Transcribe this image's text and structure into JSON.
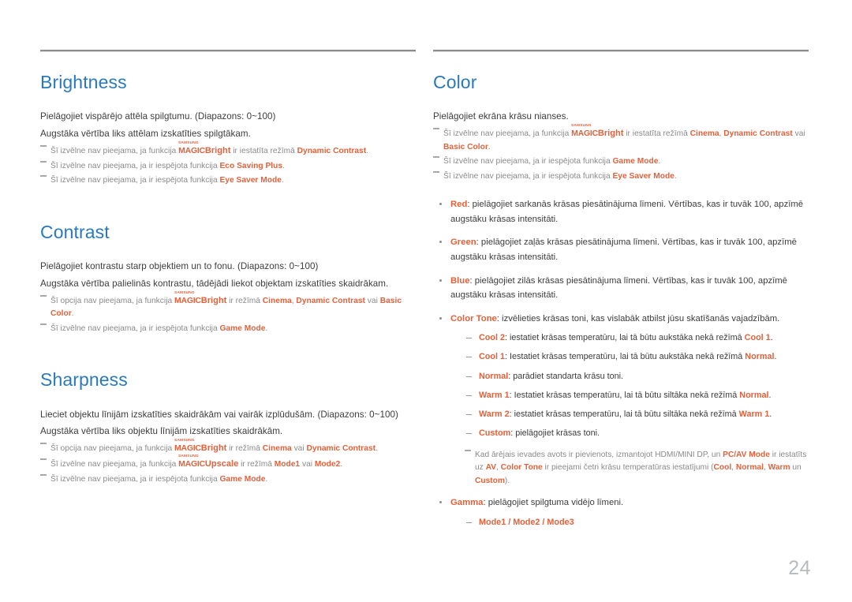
{
  "page": {
    "number": "24",
    "accent_color": "#e3613a",
    "heading_color": "#2b79bd",
    "body_color": "#3c3c3c",
    "note_color": "#8a8a8a"
  },
  "logo": {
    "samsung": "SAMSUNG",
    "magic": "MAGIC",
    "bright_suffix": "Bright",
    "upscale_suffix": "Upscale"
  },
  "left_column": {
    "sections": [
      {
        "title": "Brightness",
        "body": [
          "Pielāgojiet vispārējo attēla spilgtumu. (Diapazons: 0~100)",
          "Augstāka vērtība liks attēlam izskatīties spilgtākam."
        ],
        "notes": [
          {
            "pre": "Šī izvēlne nav pieejama, ja funkcija ",
            "logo": "bright",
            "mid": " ir iestatīta režīmā ",
            "terms": [
              "Dynamic Contrast"
            ],
            "post": "."
          },
          {
            "pre": "Šī izvēlne nav pieejama, ja ir iespējota funkcija ",
            "terms": [
              "Eco Saving Plus"
            ],
            "post": "."
          },
          {
            "pre": "Šī izvēlne nav pieejama, ja ir iespējota funkcija ",
            "terms": [
              "Eye Saver Mode"
            ],
            "post": "."
          }
        ]
      },
      {
        "title": "Contrast",
        "body": [
          "Pielāgojiet kontrastu starp objektiem un to fonu. (Diapazons: 0~100)",
          "Augstāka vērtība palielinās kontrastu, tādējādi liekot objektam izskatīties skaidrākam."
        ],
        "notes": [
          {
            "pre": "Šī opcija nav pieejama, ja funkcija ",
            "logo": "bright",
            "mid": " ir režīmā ",
            "terms": [
              "Cinema",
              "Dynamic Contrast",
              "Basic Color"
            ],
            "separators": [
              ", ",
              " vai "
            ],
            "post": "."
          },
          {
            "pre": "Šī izvēlne nav pieejama, ja ir iespējota funkcija ",
            "terms": [
              "Game Mode"
            ],
            "post": "."
          }
        ]
      },
      {
        "title": "Sharpness",
        "body": [
          "Lieciet objektu līnijām izskatīties skaidrākām vai vairāk izplūdušām. (Diapazons: 0~100)",
          "Augstāka vērtība liks objektu līnijām izskatīties skaidrākām."
        ],
        "notes": [
          {
            "pre": "Šī opcija nav pieejama, ja funkcija ",
            "logo": "bright",
            "mid": " ir režīmā ",
            "terms": [
              "Cinema",
              "Dynamic Contrast"
            ],
            "separators": [
              " vai "
            ],
            "post": "."
          },
          {
            "pre": "Šī izvēlne nav pieejama, ja funkcija ",
            "logo": "upscale",
            "mid": " ir režīmā ",
            "terms": [
              "Mode1",
              "Mode2"
            ],
            "separators": [
              " vai "
            ],
            "post": "."
          },
          {
            "pre": "Šī izvēlne nav pieejama, ja ir iespējota funkcija ",
            "terms": [
              "Game Mode"
            ],
            "post": "."
          }
        ]
      }
    ]
  },
  "right_column": {
    "title": "Color",
    "body": [
      "Pielāgojiet ekrāna krāsu nianses."
    ],
    "notes": [
      {
        "pre": "Šī izvēlne nav pieejama, ja funkcija ",
        "logo": "bright",
        "mid": " ir iestatīta režīmā ",
        "terms": [
          "Cinema",
          "Dynamic Contrast",
          "Basic Color"
        ],
        "post": "."
      },
      {
        "pre": "Šī izvēlne nav pieejama, ja ir iespējota funkcija ",
        "terms": [
          "Game Mode"
        ],
        "post": "."
      },
      {
        "pre": "Šī izvēlne nav pieejama, ja ir iespējota funkcija ",
        "terms": [
          "Eye Saver Mode"
        ],
        "post": "."
      }
    ],
    "bullets": [
      {
        "term": "Red",
        "text": ": pielāgojiet sarkanās krāsas piesātinājuma līmeni. Vērtības, kas ir tuvāk 100, apzīmē augstāku krāsas intensitāti."
      },
      {
        "term": "Green",
        "text": ": pielāgojiet zaļās krāsas piesātinājuma līmeni. Vērtības, kas ir tuvāk 100, apzīmē augstāku krāsas intensitāti."
      },
      {
        "term": "Blue",
        "text": ": pielāgojiet zilās krāsas piesātinājuma līmeni. Vērtības, kas ir tuvāk 100, apzīmē augstāku krāsas intensitāti."
      },
      {
        "term": "Color Tone",
        "text": ": izvēlieties krāsas toni, kas vislabāk atbilst jūsu skatīšanās vajadzībām.",
        "subitems": [
          {
            "term": "Cool 2",
            "pre": ": iestatiet krāsas temperatūru, lai tā būtu aukstāka nekā režīmā ",
            "ref": "Cool 1",
            "post": "."
          },
          {
            "term": "Cool 1",
            "pre": ": Iestatiet krāsas temperatūru, lai tā būtu aukstāka nekā režīmā ",
            "ref": "Normal",
            "post": "."
          },
          {
            "term": "Normal",
            "pre": ": parādiet standarta krāsu toni.",
            "ref": "",
            "post": ""
          },
          {
            "term": "Warm 1",
            "pre": ": Iestatiet krāsas temperatūru, lai tā būtu siltāka nekā režīmā ",
            "ref": "Normal",
            "post": "."
          },
          {
            "term": "Warm 2",
            "pre": ": iestatiet krāsas temperatūru, lai tā būtu siltāka nekā režīmā ",
            "ref": "Warm 1",
            "post": "."
          },
          {
            "term": "Custom",
            "pre": ": pielāgojiet krāsas toni.",
            "ref": "",
            "post": ""
          }
        ],
        "subnote": {
          "pre": "Kad ārējais ievades avots ir pievienots, izmantojot HDMI/MINI DP, un ",
          "t1": "PC/AV Mode",
          "mid1": " ir iestatīts uz ",
          "t2": "AV",
          "mid2": ", ",
          "t3": "Color Tone",
          "mid3": " ir pieejami četri krāsu temperatūras iestatījumi (",
          "t4": "Cool",
          "s1": ", ",
          "t5": "Normal",
          "s2": ", ",
          "t6": "Warm",
          "s3": " un ",
          "t7": "Custom",
          "post": ")."
        }
      },
      {
        "term": "Gamma",
        "text": ": pielāgojiet spilgtuma vidējo līmeni.",
        "modes": "Mode1 / Mode2 / Mode3"
      }
    ]
  }
}
